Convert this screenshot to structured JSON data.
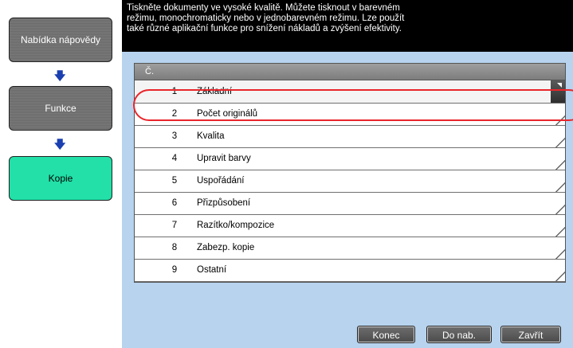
{
  "sidebar": {
    "items": [
      {
        "label": "Nabídka nápovědy"
      },
      {
        "label": "Funkce"
      },
      {
        "label": "Kopie"
      }
    ],
    "arrow_icon": "arrow-down-icon",
    "active_color": "#22e0a8",
    "arrow_color": "#1a3fb0"
  },
  "description": {
    "lines": [
      "Tiskněte dokumenty ve vysoké kvalitě. Můžete tisknout v barevném",
      "režimu, monochromaticky nebo v jednobarevném režimu. Lze použít",
      "také různé aplikační funkce pro snížení nákladů a zvýšení efektivity."
    ]
  },
  "list": {
    "header": "Č.",
    "rows": [
      {
        "num": "1",
        "label": "Základní"
      },
      {
        "num": "2",
        "label": "Počet originálů"
      },
      {
        "num": "3",
        "label": "Kvalita"
      },
      {
        "num": "4",
        "label": "Upravit barvy"
      },
      {
        "num": "5",
        "label": "Uspořádání"
      },
      {
        "num": "6",
        "label": "Přizpůsobení"
      },
      {
        "num": "7",
        "label": "Razítko/kompozice"
      },
      {
        "num": "8",
        "label": "Zabezp. kopie"
      },
      {
        "num": "9",
        "label": "Ostatní"
      }
    ],
    "selected_index": 0,
    "highlight_color": "#e8252b"
  },
  "footer": {
    "konec": "Konec",
    "do_nab": "Do nab.",
    "zavrit": "Zavřít"
  },
  "colors": {
    "content_bg": "#b7d3ee",
    "header_bg": "#000000"
  }
}
